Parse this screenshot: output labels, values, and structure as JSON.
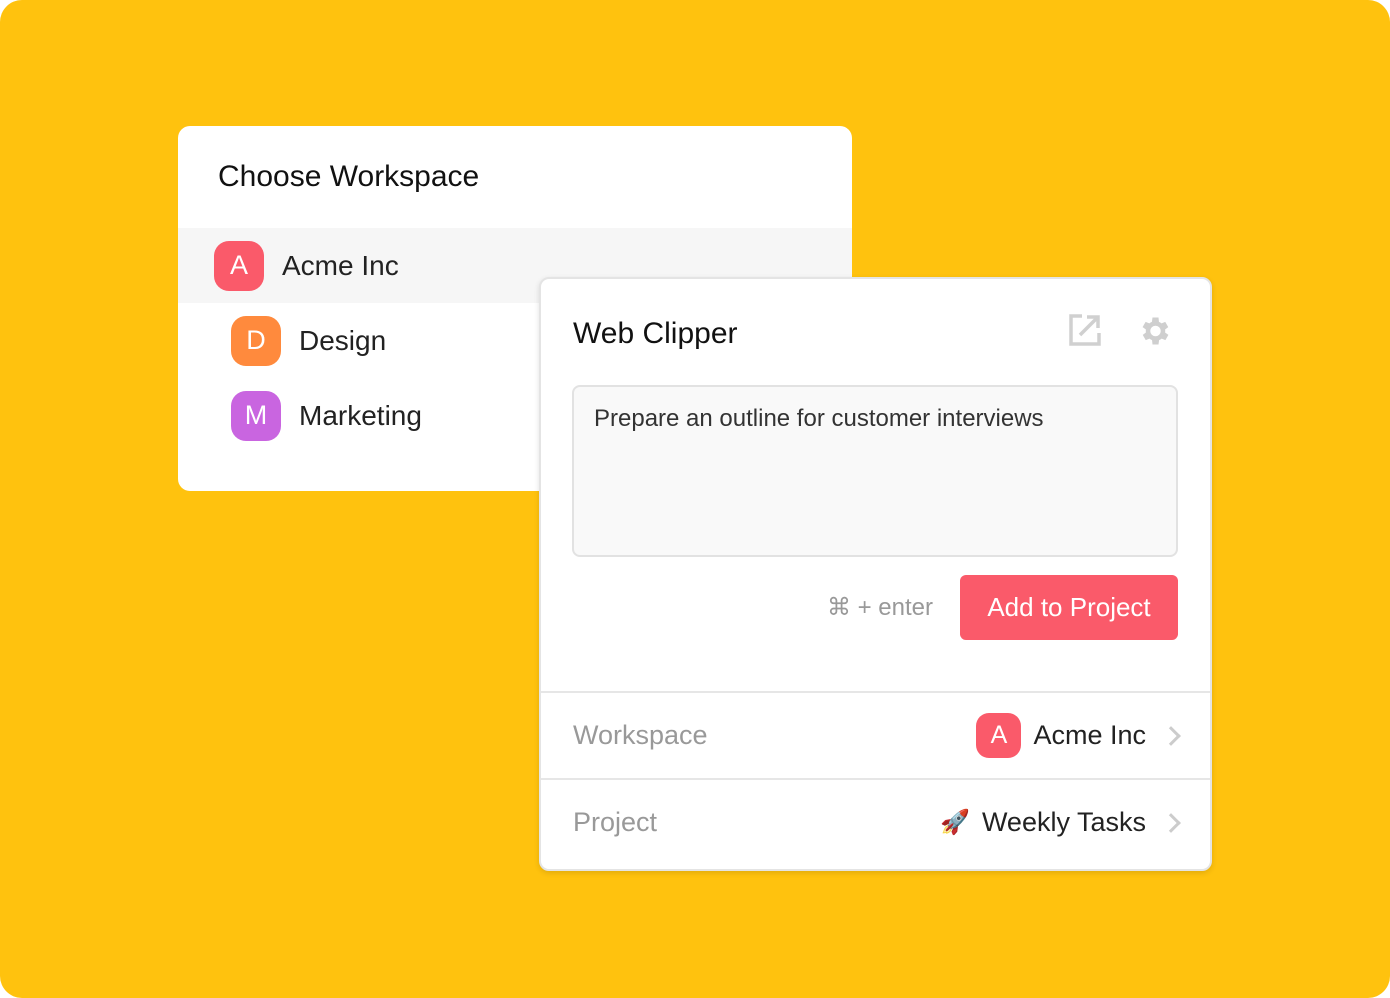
{
  "colors": {
    "background": "#FFC20E",
    "accent": "#FA5A6A"
  },
  "workspace_chooser": {
    "title": "Choose Workspace",
    "items": [
      {
        "letter": "A",
        "label": "Acme Inc",
        "color": "#FA5A6A",
        "selected": true
      },
      {
        "letter": "D",
        "label": "Design",
        "color": "#FF8A3D",
        "selected": false
      },
      {
        "letter": "M",
        "label": "Marketing",
        "color": "#C965E0",
        "selected": false
      }
    ]
  },
  "clipper": {
    "title": "Web Clipper",
    "icons": [
      "external-link-icon",
      "gear-icon"
    ],
    "task_text": "Prepare an outline for customer interviews",
    "shortcut_hint": "⌘ + enter",
    "add_button": "Add to Project",
    "workspace_label": "Workspace",
    "workspace_letter": "A",
    "workspace_value": "Acme Inc",
    "project_label": "Project",
    "project_emoji": "🚀",
    "project_value": "Weekly Tasks"
  }
}
